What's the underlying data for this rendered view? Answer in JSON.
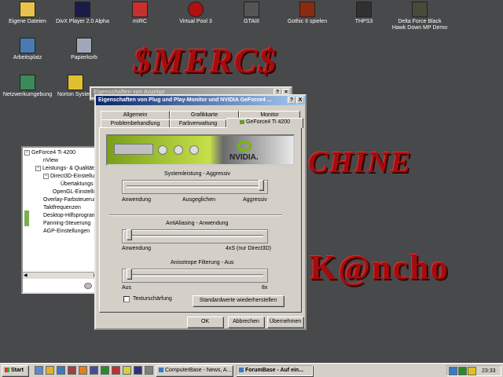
{
  "wallpaper": {
    "title": "$MERC$",
    "word2": "CHINE",
    "word3": "K@ncho"
  },
  "desktop_icons": [
    {
      "label": "Eigene Dateien",
      "color": "#e8c24a"
    },
    {
      "label": "DivX Player 2.0 Alpha",
      "color": "#1b1b4a"
    },
    {
      "label": "mIRC",
      "color": "#c83030"
    },
    {
      "label": "Virtual Pool 3",
      "color": "#b01010"
    },
    {
      "label": "GTAIII",
      "color": "#555555"
    },
    {
      "label": "Gothic II spielen",
      "color": "#8a2a10"
    },
    {
      "label": "THPS3",
      "color": "#303030"
    },
    {
      "label": "Delta Force Black Hawk Down MP Demo",
      "color": "#4a4a3a"
    },
    {
      "label": "Arbeitsplatz",
      "color": "#4a7ab0"
    },
    {
      "label": "Papierkorb",
      "color": "#a0a8b8"
    },
    {
      "label": "Netzwerkumgebung",
      "color": "#3a8a5a"
    },
    {
      "label": "Norton System",
      "color": "#e0c030"
    }
  ],
  "bg_window": {
    "title": "Eigenschaften von Anzeige"
  },
  "main_window": {
    "title": "Eigenschaften von Plug und Play-Monitor und NVIDIA GeForce4 ...",
    "help_btn": "?",
    "close_btn": "X",
    "tabs_back": [
      "Allgemein",
      "Grafikkarte",
      "Monitor"
    ],
    "tabs_front": [
      "Problembehandlung",
      "Farbverwaltung",
      "GeForce4 Ti 4200"
    ],
    "banner_logo": "NVIDIA.",
    "slider1": {
      "title": "Systemleistung - Aggressiv",
      "labels": [
        "Anwendung",
        "Ausgeglichen",
        "Aggressiv"
      ],
      "level": 1.0
    },
    "slider2": {
      "title": "AntiAliasing - Anwendung",
      "labels": [
        "Anwendung",
        "4xS (nur Direct3D)"
      ],
      "level": 0.0
    },
    "slider3": {
      "title": "Anisotrope Filterung - Aus",
      "labels": [
        "Aus",
        "8x"
      ],
      "level": 0.0
    },
    "checkbox": "Texturschärfung",
    "defaults_btn": "Standardwerte wiederherstellen",
    "ok": "OK",
    "cancel": "Abbrechen",
    "apply": "Übernehmen"
  },
  "tree_panel": {
    "items": [
      {
        "label": "GeForce4 Ti 4200",
        "icon": "gpu-icon"
      },
      {
        "label": "nView"
      },
      {
        "label": "Leistungs- & Qualitätsei"
      },
      {
        "label": "Direct3D-Einstellung"
      },
      {
        "label": "Übertaktungs o..."
      },
      {
        "label": "OpenGL-Einstellung"
      },
      {
        "label": "Overlay-Farbsteuerung"
      },
      {
        "label": "Taktfrequenzen"
      },
      {
        "label": "Desktop-Hilfsprogramme"
      },
      {
        "label": "Panning-Steuerung"
      },
      {
        "label": "AGP-Einstellungen"
      }
    ]
  },
  "taskbar": {
    "start": "Start",
    "tasks": [
      "ComputerBase - News, A...",
      "ForumBase - Auf ein..."
    ],
    "clock": "23:33"
  }
}
